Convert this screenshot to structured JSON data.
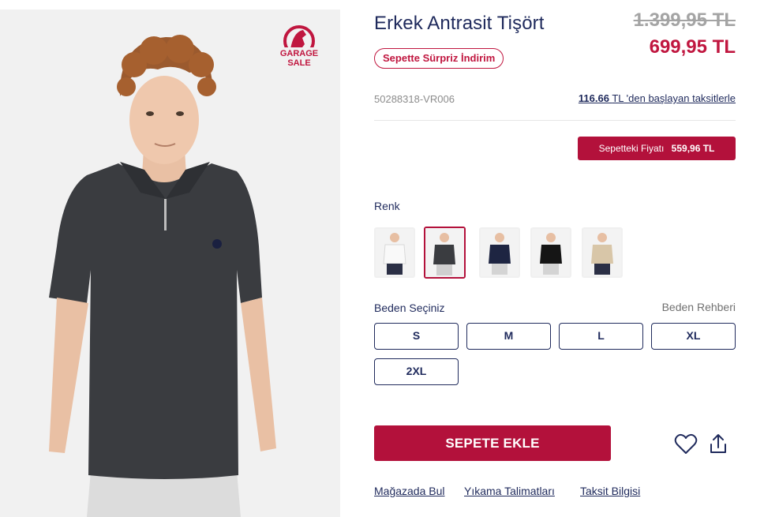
{
  "product": {
    "title": "Erkek Antrasit Tişört",
    "old_price": "1.399,95 TL",
    "new_price": "699,95 TL",
    "promo_badge": "Sepette Sürpriz İndirim",
    "sku": "50288318-VR006",
    "installment": {
      "amount": "116.66",
      "currency": "TL",
      "suffix": " 'den başlayan taksitlerle"
    },
    "cart_price": {
      "label": "Sepetteki Fiyatı",
      "value": "559,96 TL"
    }
  },
  "badge": {
    "line1": "GARAGE",
    "line2": "SALE",
    "color": "#c0163f"
  },
  "colors": {
    "label": "Renk",
    "options": [
      {
        "name": "white",
        "shirt": "#f4f4f4"
      },
      {
        "name": "anthracite",
        "shirt": "#3a3c40",
        "selected": true
      },
      {
        "name": "navy",
        "shirt": "#1e2542"
      },
      {
        "name": "black",
        "shirt": "#151515"
      },
      {
        "name": "beige",
        "shirt": "#d8c6a8"
      }
    ]
  },
  "sizes": {
    "label": "Beden Seçiniz",
    "guide": "Beden Rehberi",
    "options": [
      "S",
      "M",
      "L",
      "XL",
      "2XL"
    ]
  },
  "actions": {
    "add_to_cart": "SEPETE EKLE",
    "favorite_icon": "heart-icon",
    "share_icon": "share-icon"
  },
  "links": [
    "Mağazada Bul",
    "Yıkama Talimatları",
    "Taksit Bilgisi"
  ],
  "theme": {
    "accent": "#b3113b",
    "text": "#1f2a5c"
  }
}
